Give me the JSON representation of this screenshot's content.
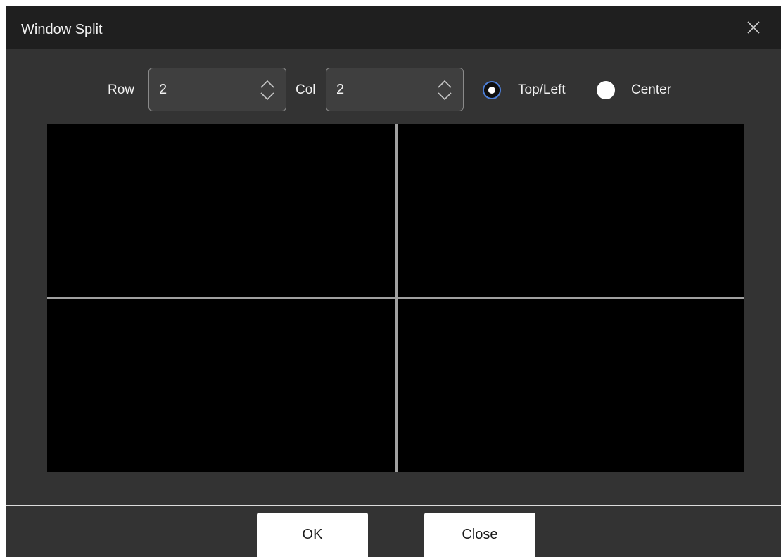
{
  "window": {
    "title": "Window Split"
  },
  "controls": {
    "row_label": "Row",
    "row_value": "2",
    "col_label": "Col",
    "col_value": "2",
    "align_options": [
      {
        "label": "Top/Left",
        "selected": true
      },
      {
        "label": "Center",
        "selected": false
      }
    ]
  },
  "preview": {
    "rows": 2,
    "cols": 2
  },
  "buttons": {
    "ok_label": "OK",
    "close_label": "Close"
  },
  "colors": {
    "dialog_bg": "#333333",
    "titlebar_bg": "#1f1f1f",
    "preview_bg": "#000000",
    "split_line": "#a0a0a0",
    "radio_accent": "#4d7fd8"
  },
  "icons": {
    "close": "close-icon",
    "spin": "chevron-up-down-icon"
  }
}
